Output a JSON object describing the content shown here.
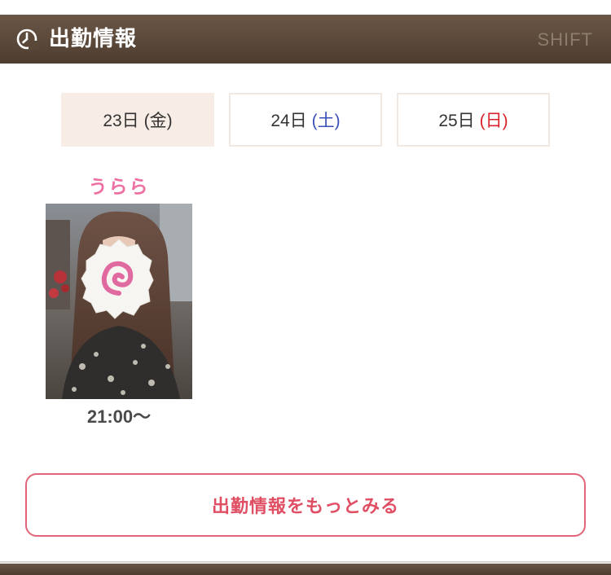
{
  "header": {
    "icon": "clock-icon",
    "title": "出勤情報",
    "subtitle": "SHIFT"
  },
  "tabs": [
    {
      "date": "23日",
      "dow": "(金)",
      "active": true,
      "dow_color": "#333333"
    },
    {
      "date": "24日",
      "dow": "(土)",
      "active": false,
      "dow_color": "#3a4fb8"
    },
    {
      "date": "25日",
      "dow": "(日)",
      "active": false,
      "dow_color": "#d8212b"
    }
  ],
  "schedule": [
    {
      "name": "うらら",
      "time": "21:00〜"
    }
  ],
  "more_button": {
    "label": "出勤情報をもっとみる"
  },
  "colors": {
    "header_bg": "#5c4a3c",
    "active_tab_bg": "#f8ece6",
    "name_pink": "#ee6fa2",
    "button_red": "#e04e63"
  }
}
